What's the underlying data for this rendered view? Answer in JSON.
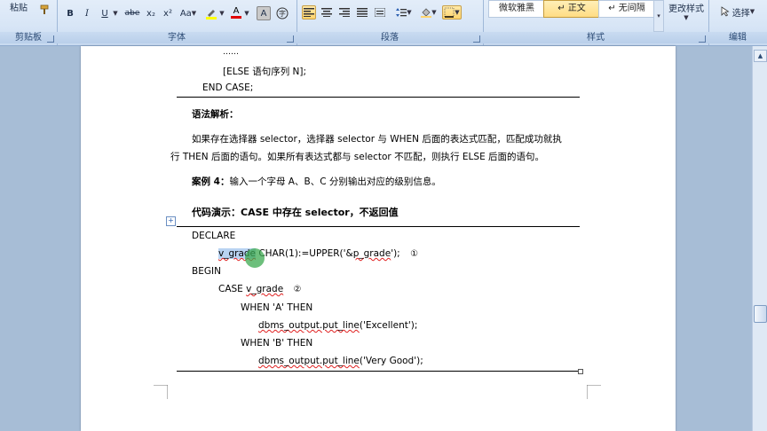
{
  "ribbon": {
    "clipboard": {
      "label": "剪贴板",
      "paste": "粘贴"
    },
    "font": {
      "label": "字体",
      "format_buttons": [
        "B",
        "I",
        "U",
        "abe",
        "x₂",
        "x²",
        "Aa",
        "A",
        "A"
      ]
    },
    "paragraph": {
      "label": "段落"
    },
    "styles": {
      "label": "样式",
      "items": [
        "微软雅黑",
        "↵ 正文",
        "↵ 无间隔"
      ],
      "more": "更改样式"
    },
    "editing": {
      "label": "编辑",
      "select": "选择"
    }
  },
  "document": {
    "lines": {
      "ellipsis": "……",
      "else_clause": "[ELSE 语句序列 N];",
      "end_case": "END CASE;",
      "syntax_title": "语法解析：",
      "para1": "如果存在选择器 selector，选择器 selector 与 WHEN 后面的表达式匹配，匹配成功就执",
      "para2": "行 THEN 后面的语句。如果所有表达式都与 selector 不匹配，则执行 ELSE 后面的语句。",
      "case_label": "案例 4：",
      "case_text": "输入一个字母 A、B、C 分别输出对应的级别信息。",
      "demo_title": "代码演示：CASE 中存在 selector，不返回值",
      "declare": "DECLARE",
      "var_name": "v_grade",
      "var_rest_a": " CHAR(1):=UPPER('&",
      "var_param": "p_grade",
      "var_rest_b": "');",
      "mark1": "①",
      "begin": "BEGIN",
      "case_kw": "CASE ",
      "case_var": "v_grade",
      "mark2": "②",
      "when_a": "WHEN 'A' THEN",
      "put_a_fn": "dbms_output.put_line",
      "put_a_arg": "('Excellent');",
      "when_b": "WHEN 'B' THEN",
      "put_b_fn": "dbms_output.put_line",
      "put_b_arg": "('Very Good');"
    }
  },
  "colors": {
    "accent": "#ffd56e",
    "ribbon": "#d7e5f6",
    "squiggle": "#e02020",
    "selection": "#b9d3f2"
  }
}
